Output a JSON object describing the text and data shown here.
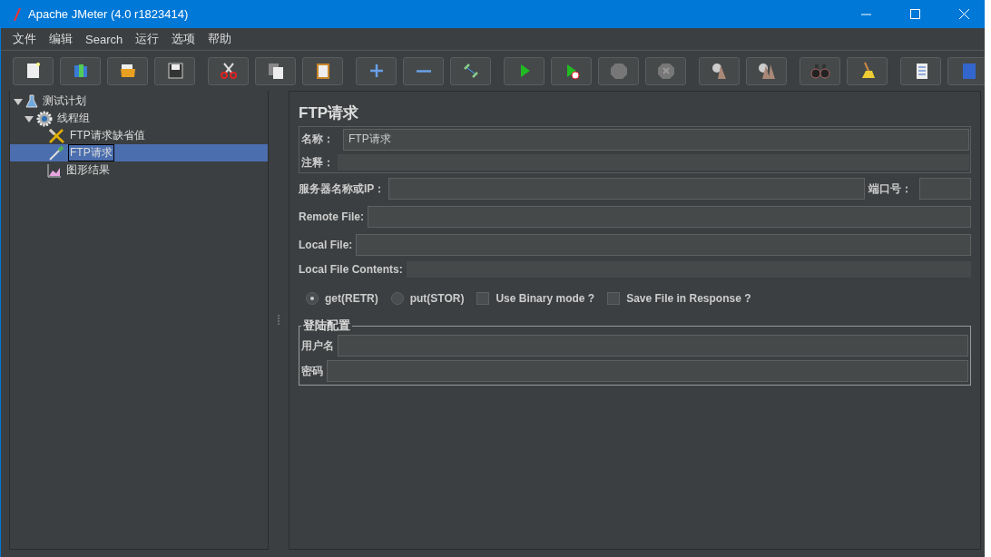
{
  "window": {
    "title": "Apache JMeter (4.0 r1823414)"
  },
  "menu": [
    {
      "label": "文件"
    },
    {
      "label": "编辑"
    },
    {
      "label": "Search"
    },
    {
      "label": "运行"
    },
    {
      "label": "选项"
    },
    {
      "label": "帮助"
    }
  ],
  "tree": [
    {
      "label": "测试计划",
      "kind": "flask",
      "expanded": true,
      "selected": false,
      "children": [
        {
          "label": "线程组",
          "kind": "gear",
          "expanded": true,
          "selected": false,
          "children": [
            {
              "label": "FTP请求缺省值",
              "kind": "tools",
              "selected": false
            },
            {
              "label": "FTP请求",
              "kind": "sampler",
              "selected": true
            },
            {
              "label": "图形结果",
              "kind": "graph",
              "selected": false
            }
          ]
        }
      ]
    }
  ],
  "panel": {
    "title": "FTP请求",
    "name": {
      "label": "名称：",
      "value": "FTP请求"
    },
    "comment": {
      "label": "注释："
    },
    "server": {
      "label": "服务器名称或IP："
    },
    "port": {
      "label": "端口号："
    },
    "remote_file": {
      "label": "Remote File:"
    },
    "local_file": {
      "label": "Local File:"
    },
    "local_file_contents": {
      "label": "Local File Contents:"
    },
    "options": [
      {
        "kind": "radio",
        "label": "get(RETR)",
        "selected": true
      },
      {
        "kind": "radio",
        "label": "put(STOR)",
        "selected": false
      },
      {
        "kind": "checkbox",
        "label": "Use Binary mode ?",
        "checked": false
      },
      {
        "kind": "checkbox",
        "label": "Save File in Response ?",
        "checked": false
      }
    ],
    "login": {
      "title": "登陆配置",
      "username": {
        "label": "用户名"
      },
      "password": {
        "label": "密码"
      }
    }
  }
}
